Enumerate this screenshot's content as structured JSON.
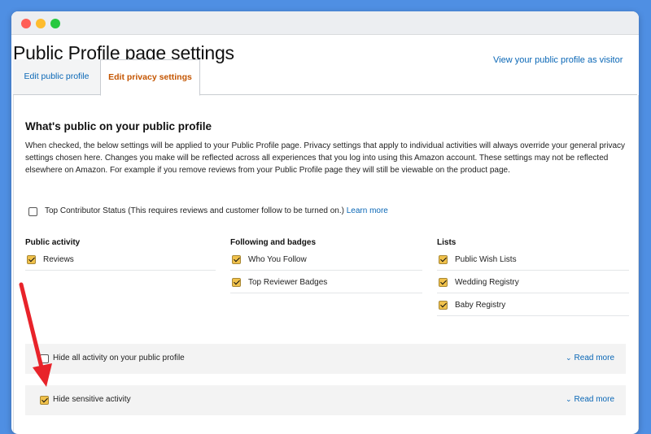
{
  "header": {
    "title": "Public Profile page settings",
    "visitor_link": "View your public profile as visitor"
  },
  "tabs": [
    {
      "label": "Edit public profile",
      "active": false
    },
    {
      "label": "Edit privacy settings",
      "active": true
    }
  ],
  "privacy": {
    "heading": "What's public on your public profile",
    "description": "When checked, the below settings will be applied to your Public Profile page. Privacy settings that apply to individual activities will always override your general privacy settings chosen here. Changes you make will be reflected across all experiences that you log into using this Amazon account. These settings may not be reflected elsewhere on Amazon. For example if you remove reviews from your Public Profile page they will still be viewable on the product page.",
    "top_contributor": {
      "label": "Top Contributor Status (This requires reviews and customer follow to be turned on.)",
      "link": "Learn more",
      "checked": false
    },
    "columns": [
      {
        "title": "Public activity",
        "items": [
          {
            "label": "Reviews",
            "checked": true
          }
        ]
      },
      {
        "title": "Following and badges",
        "items": [
          {
            "label": "Who You Follow",
            "checked": true
          },
          {
            "label": "Top Reviewer Badges",
            "checked": true
          }
        ]
      },
      {
        "title": "Lists",
        "items": [
          {
            "label": "Public Wish Lists",
            "checked": true
          },
          {
            "label": "Wedding Registry",
            "checked": true
          },
          {
            "label": "Baby Registry",
            "checked": true
          }
        ]
      }
    ],
    "hide_all": {
      "label": "Hide all activity on your public profile",
      "checked": false,
      "read_more": "Read more"
    },
    "hide_sensitive": {
      "label": "Hide sensitive activity",
      "checked": true,
      "read_more": "Read more"
    }
  },
  "colors": {
    "background": "#4f8fe3",
    "link": "#0a67b6",
    "active_tab": "#c45500",
    "checkbox_checked": "#f0c14b",
    "arrow": "#e8232a"
  },
  "icons": [
    "chevron-down-icon",
    "checkbox-icon",
    "red-arrow-annotation"
  ]
}
